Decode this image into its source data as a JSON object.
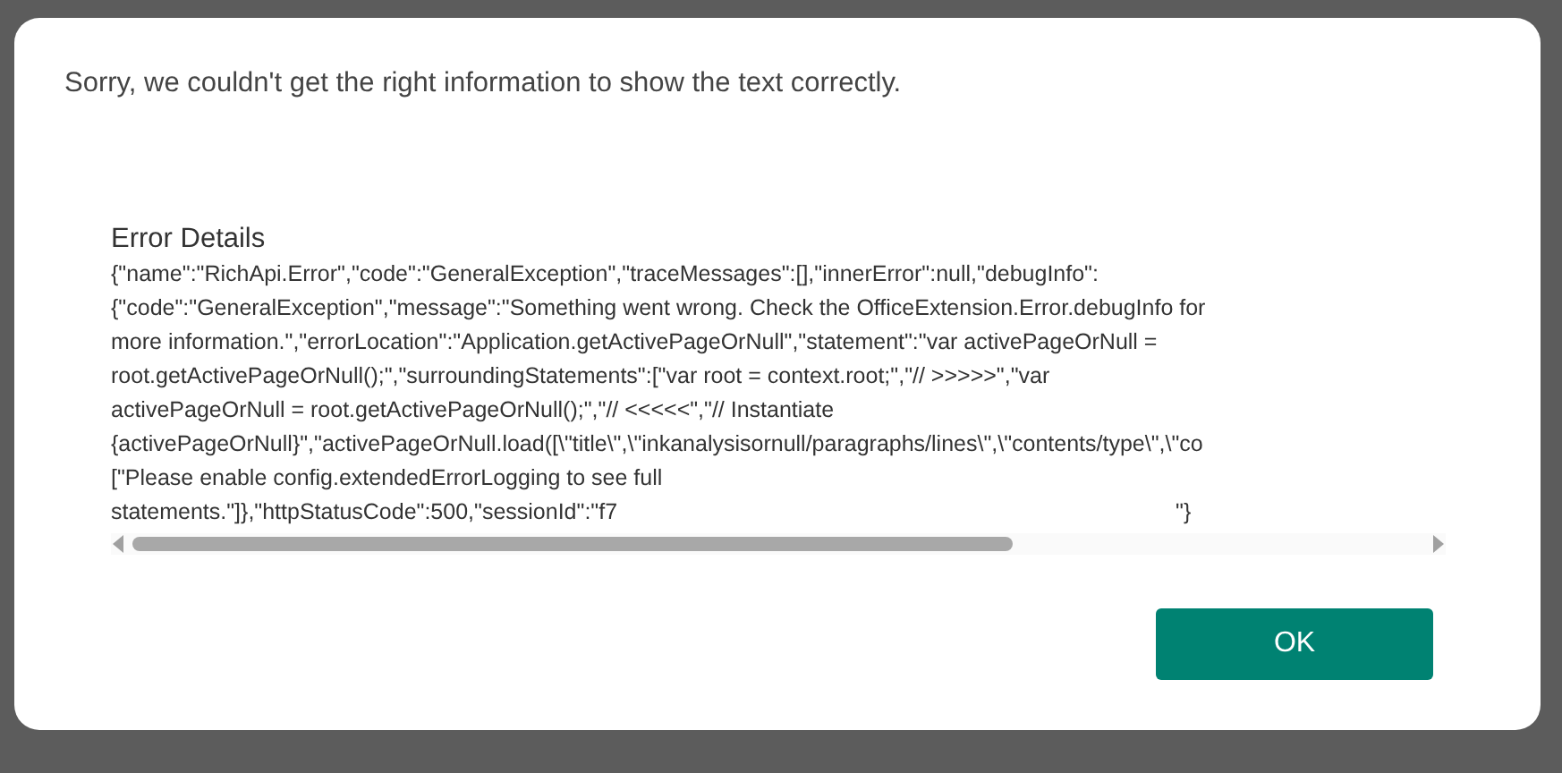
{
  "dialog": {
    "message": "Sorry, we couldn't get the right information to show the text correctly.",
    "details_heading": "Error Details",
    "details_lines": [
      "{\"name\":\"RichApi.Error\",\"code\":\"GeneralException\",\"traceMessages\":[],\"innerError\":null,\"debugInfo\":",
      "{\"code\":\"GeneralException\",\"message\":\"Something went wrong. Check the OfficeExtension.Error.debugInfo for",
      "more information.\",\"errorLocation\":\"Application.getActivePageOrNull\",\"statement\":\"var activePageOrNull =",
      "root.getActivePageOrNull();\",\"surroundingStatements\":[\"var root = context.root;\",\"// >>>>>\",\"var",
      "activePageOrNull = root.getActivePageOrNull();\",\"// <<<<<\",\"// Instantiate",
      "{activePageOrNull}\",\"activePageOrNull.load([\\\"title\\\",\\\"inkanalysisornull/paragraphs/lines\\\",\\\"contents/type\\\",\\\"co",
      "[\"Please enable config.extendedErrorLogging to see full",
      "statements.\"]},\"httpStatusCode\":500,\"sessionId\":\"f7"
    ],
    "details_tail": "\"}",
    "ok_button": "OK"
  }
}
